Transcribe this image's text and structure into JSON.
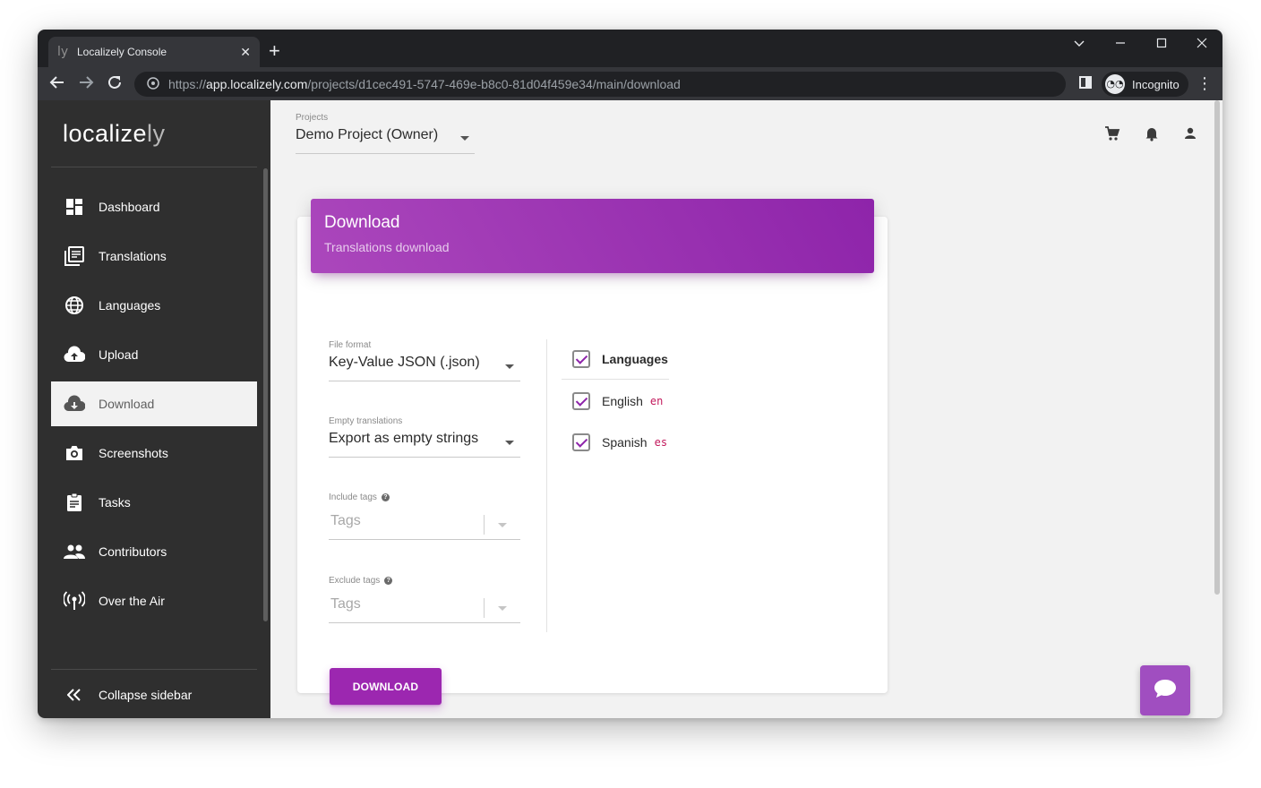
{
  "browser": {
    "tab_title": "Localizely Console",
    "tab_favicon": "ly",
    "url_scheme": "https://",
    "url_host": "app.localizely.com",
    "url_path": "/projects/d1cec491-5747-469e-b8c0-81d04f459e34/main/download",
    "profile_label": "Incognito"
  },
  "sidebar": {
    "logo_main": "localize",
    "logo_suffix": "ly",
    "items": [
      {
        "label": "Dashboard",
        "icon": "dashboard-icon"
      },
      {
        "label": "Translations",
        "icon": "translations-icon"
      },
      {
        "label": "Languages",
        "icon": "globe-icon"
      },
      {
        "label": "Upload",
        "icon": "cloud-upload-icon"
      },
      {
        "label": "Download",
        "icon": "cloud-download-icon"
      },
      {
        "label": "Screenshots",
        "icon": "camera-icon"
      },
      {
        "label": "Tasks",
        "icon": "clipboard-icon"
      },
      {
        "label": "Contributors",
        "icon": "people-icon"
      },
      {
        "label": "Over the Air",
        "icon": "antenna-icon"
      }
    ],
    "active_item": "Download",
    "collapse_label": "Collapse sidebar"
  },
  "header": {
    "projects_label": "Projects",
    "project_name": "Demo Project (Owner)"
  },
  "card": {
    "title": "Download",
    "subtitle": "Translations download",
    "file_format_label": "File format",
    "file_format_value": "Key-Value JSON (.json)",
    "empty_translations_label": "Empty translations",
    "empty_translations_value": "Export as empty strings",
    "include_tags_label": "Include tags",
    "include_tags_placeholder": "Tags",
    "exclude_tags_label": "Exclude tags",
    "exclude_tags_placeholder": "Tags",
    "languages_label": "Languages",
    "languages": [
      {
        "name": "English",
        "code": "en",
        "checked": true
      },
      {
        "name": "Spanish",
        "code": "es",
        "checked": true
      }
    ],
    "download_button": "DOWNLOAD"
  },
  "colors": {
    "accent": "#9c27b0",
    "sidebar_bg": "#2f2f2f",
    "lang_code": "#c2185b"
  }
}
